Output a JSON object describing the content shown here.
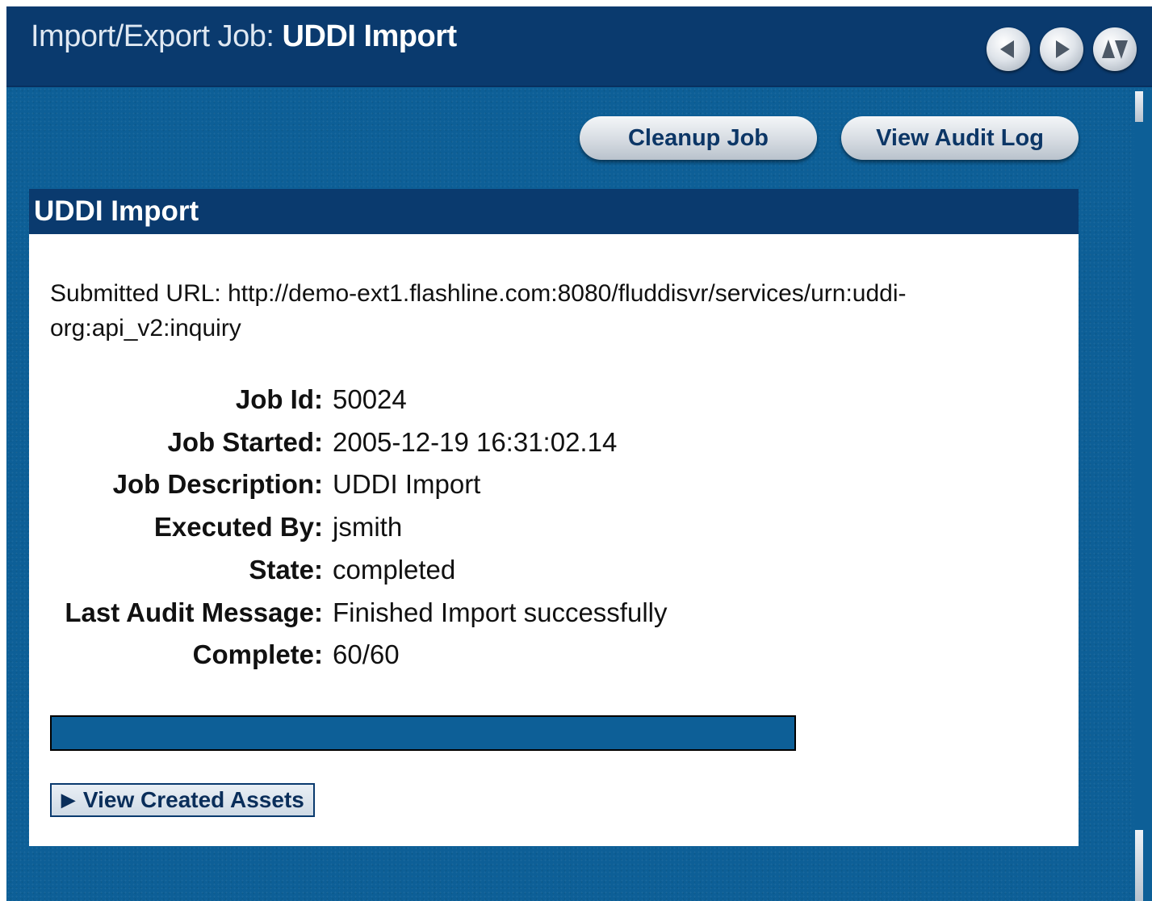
{
  "window": {
    "title_prefix": "Import/Export Job: ",
    "title_name": "UDDI Import",
    "nav_icons": [
      "back-arrow-icon",
      "forward-arrow-icon",
      "collapse-toggle-icon"
    ]
  },
  "toolbar": {
    "cleanup_label": "Cleanup Job",
    "audit_label": "View Audit Log"
  },
  "panel": {
    "title": "UDDI Import",
    "submitted_url": "Submitted URL: http://demo-ext1.flashline.com:8080/fluddisvr/services/urn:uddi-org:api_v2:inquiry",
    "details": [
      {
        "label": "Job Id:",
        "value": "50024"
      },
      {
        "label": "Job Started:",
        "value": "2005-12-19 16:31:02.14"
      },
      {
        "label": "Job Description:",
        "value": "UDDI Import"
      },
      {
        "label": "Executed By:",
        "value": "jsmith"
      },
      {
        "label": "State:",
        "value": "completed"
      },
      {
        "label": "Last Audit Message:",
        "value": "Finished Import successfully"
      },
      {
        "label": "Complete:",
        "value": "60/60"
      }
    ],
    "progress_fraction": 1.0,
    "view_assets_label": "View Created Assets"
  },
  "colors": {
    "background_blue": "#0d5f97",
    "header_navy": "#0a3a6e",
    "button_text": "#0c3666"
  }
}
